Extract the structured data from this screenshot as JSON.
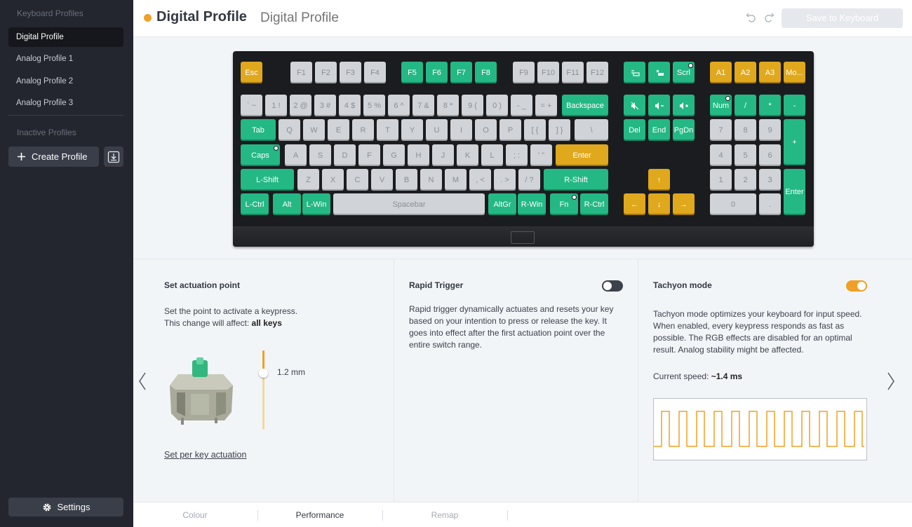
{
  "sidebar": {
    "keyboard_profiles_heading": "Keyboard Profiles",
    "profiles": [
      {
        "label": "Digital Profile",
        "active": true
      },
      {
        "label": "Analog Profile 1"
      },
      {
        "label": "Analog Profile 2"
      },
      {
        "label": "Analog Profile 3"
      }
    ],
    "inactive_heading": "Inactive Profiles",
    "create_profile_label": "Create Profile",
    "settings_label": "Settings"
  },
  "header": {
    "title": "Digital Profile",
    "name_input_placeholder": "Digital Profile",
    "save_label": "Save to Keyboard",
    "accent_color": "#f0a024"
  },
  "keyboard": {
    "colors": {
      "yellow": "#e0a81c",
      "green": "#24b885",
      "white": "#d0d3d7"
    },
    "keys": [
      {
        "label": "Esc",
        "c": "y"
      },
      {
        "label": "F1",
        "c": "w"
      },
      {
        "label": "F2",
        "c": "w"
      },
      {
        "label": "F3",
        "c": "w"
      },
      {
        "label": "F4",
        "c": "w"
      },
      {
        "label": "F5",
        "c": "g"
      },
      {
        "label": "F6",
        "c": "g"
      },
      {
        "label": "F7",
        "c": "g"
      },
      {
        "label": "F8",
        "c": "g"
      },
      {
        "label": "F9",
        "c": "w"
      },
      {
        "label": "F10",
        "c": "w"
      },
      {
        "label": "F11",
        "c": "w"
      },
      {
        "label": "F12",
        "c": "w"
      },
      {
        "label": "",
        "c": "g",
        "icon": "prtsc"
      },
      {
        "label": "",
        "c": "g",
        "icon": "pause"
      },
      {
        "label": "Scrl",
        "c": "g",
        "dot": true
      },
      {
        "label": "A1",
        "c": "y"
      },
      {
        "label": "A2",
        "c": "y"
      },
      {
        "label": "A3",
        "c": "y"
      },
      {
        "label": "Mo...",
        "c": "y"
      },
      {
        "label": "` ~",
        "c": "w"
      },
      {
        "label": "1 !",
        "c": "w"
      },
      {
        "label": "2 @",
        "c": "w"
      },
      {
        "label": "3 #",
        "c": "w"
      },
      {
        "label": "4 $",
        "c": "w"
      },
      {
        "label": "5 %",
        "c": "w"
      },
      {
        "label": "6 ^",
        "c": "w"
      },
      {
        "label": "7 &",
        "c": "w"
      },
      {
        "label": "8 *",
        "c": "w"
      },
      {
        "label": "9 (",
        "c": "w"
      },
      {
        "label": "0 )",
        "c": "w"
      },
      {
        "label": "- _",
        "c": "w"
      },
      {
        "label": "= +",
        "c": "w"
      },
      {
        "label": "Backspace",
        "c": "g"
      },
      {
        "label": "",
        "c": "g",
        "icon": "mute"
      },
      {
        "label": "",
        "c": "g",
        "icon": "voldown"
      },
      {
        "label": "",
        "c": "g",
        "icon": "volup"
      },
      {
        "label": "Num",
        "c": "g",
        "dot": true
      },
      {
        "label": "/",
        "c": "g"
      },
      {
        "label": "*",
        "c": "g"
      },
      {
        "label": "-",
        "c": "g"
      },
      {
        "label": "Tab",
        "c": "g"
      },
      {
        "label": "Q",
        "c": "w"
      },
      {
        "label": "W",
        "c": "w"
      },
      {
        "label": "E",
        "c": "w"
      },
      {
        "label": "R",
        "c": "w"
      },
      {
        "label": "T",
        "c": "w"
      },
      {
        "label": "Y",
        "c": "w"
      },
      {
        "label": "U",
        "c": "w"
      },
      {
        "label": "I",
        "c": "w"
      },
      {
        "label": "O",
        "c": "w"
      },
      {
        "label": "P",
        "c": "w"
      },
      {
        "label": "[ {",
        "c": "w"
      },
      {
        "label": "] }",
        "c": "w"
      },
      {
        "label": "\\",
        "c": "w"
      },
      {
        "label": "Del",
        "c": "g"
      },
      {
        "label": "End",
        "c": "g"
      },
      {
        "label": "PgDn",
        "c": "g"
      },
      {
        "label": "7",
        "c": "w"
      },
      {
        "label": "8",
        "c": "w"
      },
      {
        "label": "9",
        "c": "w"
      },
      {
        "label": "+",
        "c": "g"
      },
      {
        "label": "Caps",
        "c": "g",
        "dot": true
      },
      {
        "label": "A",
        "c": "w"
      },
      {
        "label": "S",
        "c": "w"
      },
      {
        "label": "D",
        "c": "w"
      },
      {
        "label": "F",
        "c": "w"
      },
      {
        "label": "G",
        "c": "w"
      },
      {
        "label": "H",
        "c": "w"
      },
      {
        "label": "J",
        "c": "w"
      },
      {
        "label": "K",
        "c": "w"
      },
      {
        "label": "L",
        "c": "w"
      },
      {
        "label": "; :",
        "c": "w"
      },
      {
        "label": "' \"",
        "c": "w"
      },
      {
        "label": "Enter",
        "c": "y"
      },
      {
        "label": "4",
        "c": "w"
      },
      {
        "label": "5",
        "c": "w"
      },
      {
        "label": "6",
        "c": "w"
      },
      {
        "label": "L-Shift",
        "c": "g"
      },
      {
        "label": "Z",
        "c": "w"
      },
      {
        "label": "X",
        "c": "w"
      },
      {
        "label": "C",
        "c": "w"
      },
      {
        "label": "V",
        "c": "w"
      },
      {
        "label": "B",
        "c": "w"
      },
      {
        "label": "N",
        "c": "w"
      },
      {
        "label": "M",
        "c": "w"
      },
      {
        "label": ", <",
        "c": "w"
      },
      {
        "label": ". >",
        "c": "w"
      },
      {
        "label": "/ ?",
        "c": "w"
      },
      {
        "label": "R-Shift",
        "c": "g"
      },
      {
        "label": "↑",
        "c": "y"
      },
      {
        "label": "1",
        "c": "w"
      },
      {
        "label": "2",
        "c": "w"
      },
      {
        "label": "3",
        "c": "w"
      },
      {
        "label": "Enter",
        "c": "g"
      },
      {
        "label": "L-Ctrl",
        "c": "g"
      },
      {
        "label": "Alt",
        "c": "g"
      },
      {
        "label": "L-Win",
        "c": "g"
      },
      {
        "label": "Spacebar",
        "c": "w"
      },
      {
        "label": "AltGr",
        "c": "g"
      },
      {
        "label": "R-Win",
        "c": "g"
      },
      {
        "label": "Fn",
        "c": "g",
        "dot": true
      },
      {
        "label": "R-Ctrl",
        "c": "g"
      },
      {
        "label": "←",
        "c": "y"
      },
      {
        "label": "↓",
        "c": "y"
      },
      {
        "label": "→",
        "c": "y"
      },
      {
        "label": "0",
        "c": "w"
      },
      {
        "label": ".",
        "c": "w"
      }
    ]
  },
  "actuation": {
    "title": "Set actuation point",
    "desc_line1": "Set the point to activate a keypress.",
    "desc_line2_prefix": "This change will affect:",
    "desc_line2_bold": "all keys",
    "value_label": "1.2 mm",
    "value_fraction": 0.28,
    "per_key_link": "Set per key actuation"
  },
  "rapid_trigger": {
    "title": "Rapid Trigger",
    "enabled": false,
    "desc": "Rapid trigger dynamically actuates and resets your key based on your intention to press or release the key. It goes into effect after the first actuation point over the entire switch range."
  },
  "tachyon": {
    "title": "Tachyon mode",
    "enabled": true,
    "desc": "Tachyon mode optimizes your keyboard for input speed. When enabled, every keypress responds as fast as possible. The RGB effects are disabled for an optimal result. Analog stability might be affected.",
    "speed_prefix": "Current speed:",
    "speed_value": "~1.4 ms",
    "wave_color": "#f0a024"
  },
  "tabs": [
    {
      "label": "Colour",
      "active": false
    },
    {
      "label": "Performance",
      "active": true
    },
    {
      "label": "Remap",
      "active": false
    }
  ]
}
